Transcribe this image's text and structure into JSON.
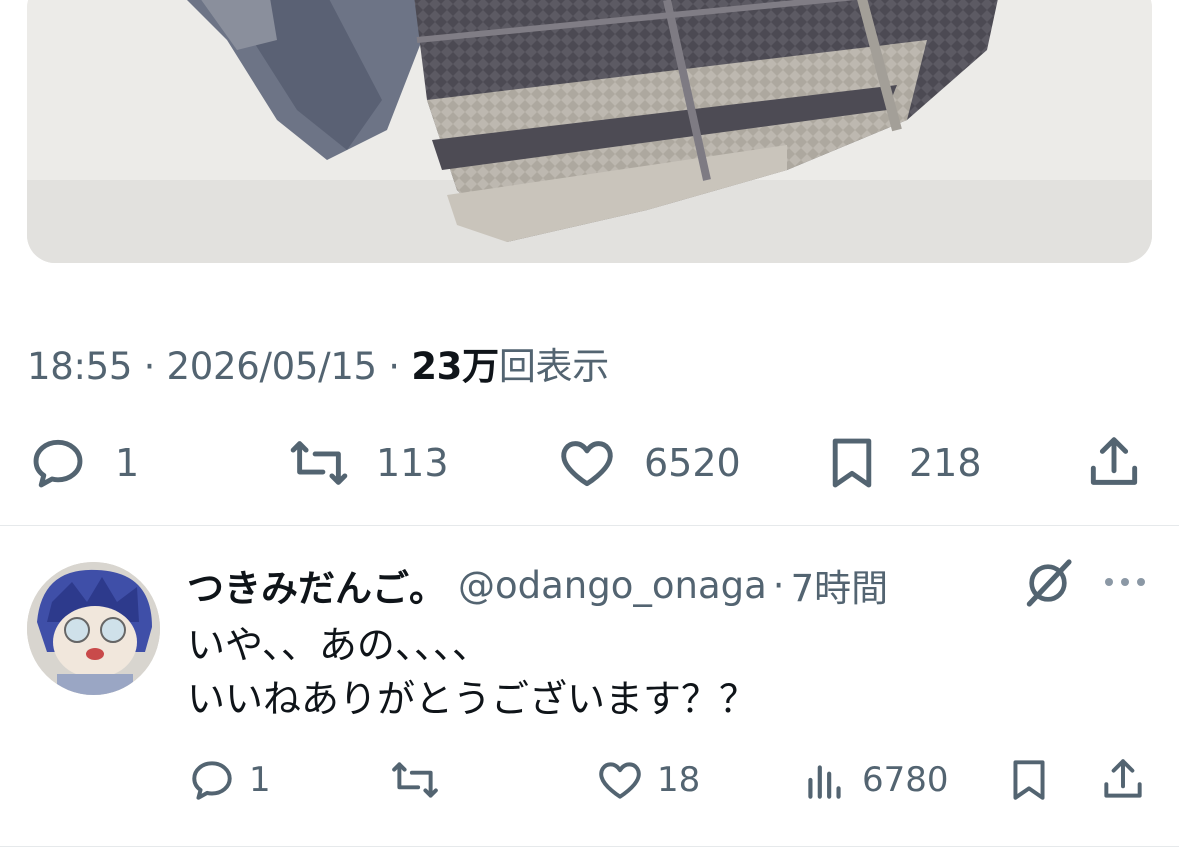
{
  "tweet": {
    "time": "18:55",
    "separator": "·",
    "date": "2026/05/15",
    "views_count": "23万",
    "views_label": "回表示",
    "actions": {
      "reply": {
        "icon": "reply-icon",
        "count": "1"
      },
      "retweet": {
        "icon": "retweet-icon",
        "count": "113"
      },
      "like": {
        "icon": "heart-icon",
        "count": "6520"
      },
      "bookmark": {
        "icon": "bookmark-icon",
        "count": "218"
      },
      "share": {
        "icon": "share-icon"
      }
    }
  },
  "reply": {
    "display_name": "つきみだんご。",
    "handle": "@odango_onaga",
    "separator": "·",
    "time": "7時間",
    "text_lines": [
      "いや、、あの、、、、",
      "いいねありがとうございます？？"
    ],
    "actions": {
      "reply": {
        "icon": "reply-icon",
        "count": "1"
      },
      "retweet": {
        "icon": "retweet-icon",
        "count": ""
      },
      "like": {
        "icon": "heart-icon",
        "count": "18"
      },
      "views": {
        "icon": "views-chart-icon",
        "count": "6780"
      },
      "bookmark": {
        "icon": "bookmark-icon"
      },
      "share": {
        "icon": "share-icon"
      }
    }
  },
  "colors": {
    "text_primary": "#0f1419",
    "text_secondary": "#536471",
    "divider": "#e6e9eb"
  }
}
